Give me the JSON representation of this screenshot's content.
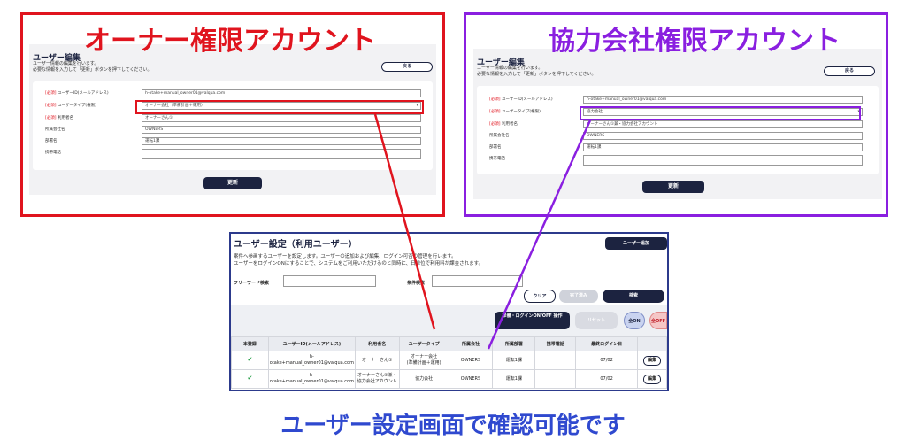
{
  "callouts": {
    "owner": "オーナー権限アカウント",
    "partner": "協力会社権限アカウント",
    "bottom": "ユーザー設定画面で確認可能です"
  },
  "edit_owner": {
    "title": "ユーザー編集",
    "desc1": "ユーザー情報の編集を行います。",
    "desc2": "必要な情報を入力して「更新」ボタンを押下してください。",
    "back_label": "戻る",
    "required_tag": "[必須]",
    "fields": [
      {
        "label": "ユーザーID(メールアドレス)",
        "required": true,
        "value": "h-otake+manual_owner01@valqua.com"
      },
      {
        "label": "ユーザータイプ(権限)",
        "required": true,
        "value": "オーナー会社（準備計画＋運用）"
      },
      {
        "label": "利用者名",
        "required": true,
        "value": "オーナーさん①"
      },
      {
        "label": "所属会社名",
        "required": false,
        "value": "OWNERS"
      },
      {
        "label": "部署名",
        "required": false,
        "value": "運転1課"
      },
      {
        "label": "携帯電話",
        "required": false,
        "value": ""
      }
    ],
    "update_label": "更新"
  },
  "edit_partner": {
    "title": "ユーザー編集",
    "desc1": "ユーザー情報の編集を行います。",
    "desc2": "必要な情報を入力して「更新」ボタンを押下してください。",
    "back_label": "戻る",
    "required_tag": "[必須]",
    "fields": [
      {
        "label": "ユーザーID(メールアドレス)",
        "required": true,
        "value": "h-otake+manual_owner01@valqua.com"
      },
      {
        "label": "ユーザータイプ(権限)",
        "required": true,
        "value": "協力会社"
      },
      {
        "label": "利用者名",
        "required": true,
        "value": "オーナーさん①兼・協力会社アカウント"
      },
      {
        "label": "所属会社名",
        "required": false,
        "value": "OWNERS"
      },
      {
        "label": "部署名",
        "required": false,
        "value": "運転1課"
      },
      {
        "label": "携帯電話",
        "required": false,
        "value": ""
      }
    ],
    "update_label": "更新"
  },
  "settings": {
    "title": "ユーザー設定（利用ユーザー）",
    "desc1": "案件へ参画するユーザーを設定します。ユーザーの追加および編集、ログイン可否の管理を行います。",
    "desc2": "ユーザーをログインONにすることで、システムをご利用いただけるのと同時に、日単位で利用料が課金されます。",
    "add_user": "ユーザー追加",
    "freeword_label": "フリーワード検索",
    "condition_label": "条件検索",
    "clear": "クリア",
    "finish": "完了済み",
    "search": "検索",
    "login_toggle": "準備・ログインON/OFF 操作",
    "reset": "リセット",
    "all_on": "全ON",
    "all_off": "全OFF",
    "columns": [
      "本登録",
      "ユーザーID(メールアドレス)",
      "利用者名",
      "ユーザータイプ",
      "所属会社",
      "所属部署",
      "携帯電話",
      "最終ログイン日",
      ""
    ],
    "rows": [
      {
        "id1": "h-",
        "id2": "otake+manual_owner01@valqua.com",
        "name1": "オーナーさん①",
        "name2": "",
        "type1": "オーナー会社",
        "type2": "(準備計画＋運用)",
        "company": "OWNERS",
        "dept": "運転1課",
        "phone": "",
        "last": "07/02",
        "edit": "編集"
      },
      {
        "id1": "h-",
        "id2": "otake+manual_owner01@valqua.com",
        "name1": "オーナーさん①兼・",
        "name2": "協力会社アカウント",
        "type1": "協力会社",
        "type2": "",
        "company": "OWNERS",
        "dept": "運転1課",
        "phone": "",
        "last": "07/02",
        "edit": "編集"
      }
    ]
  },
  "colors": {
    "owner_red": "#e0141e",
    "partner_purple": "#8a1fe0",
    "navy": "#1c2340",
    "caption_blue": "#2f49cf",
    "check_green": "#2aa04a"
  }
}
